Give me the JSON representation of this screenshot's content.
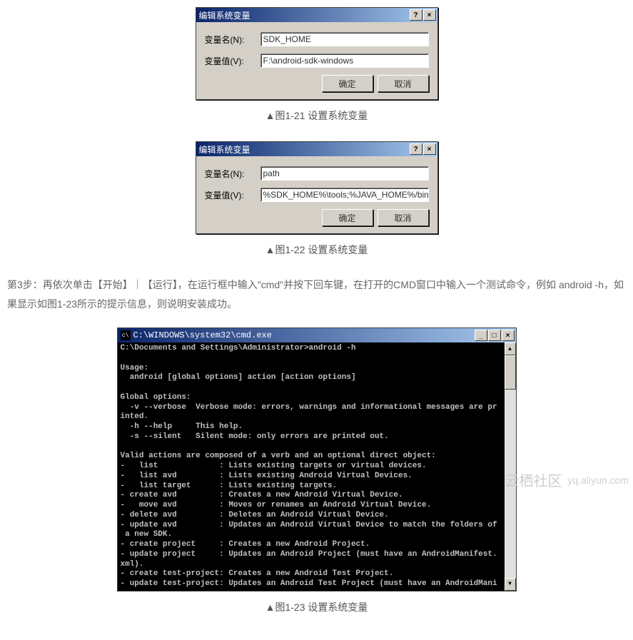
{
  "dialog1": {
    "title": "编辑系统变量",
    "name_label": "变量名(N):",
    "name_value": "SDK_HOME",
    "value_label": "变量值(V):",
    "value_value": "F:\\android-sdk-windows",
    "ok": "确定",
    "cancel": "取消"
  },
  "caption1": "▲图1-21 设置系统变量",
  "dialog2": {
    "title": "编辑系统变量",
    "name_label": "变量名(N):",
    "name_value": "path",
    "value_label": "变量值(V):",
    "value_value": "%SDK_HOME%\\tools;%JAVA_HOME%/bin;C:\\",
    "ok": "确定",
    "cancel": "取消"
  },
  "caption2": "▲图1-22 设置系统变量",
  "para1": "第3步：再依次单击【开始】｜【运行】，在运行框中输入\"cmd\"并按下回车键，在打开的CMD窗口中输入一个测试命令，例如 android -h，如果显示如图1-23所示的提示信息，则说明安装成功。",
  "cmd": {
    "title": "C:\\WINDOWS\\system32\\cmd.exe",
    "lines": "C:\\Documents and Settings\\Administrator>android -h\n\nUsage:\n  android [global options] action [action options]\n\nGlobal options:\n  -v --verbose  Verbose mode: errors, warnings and informational messages are pr\ninted.\n  -h --help     This help.\n  -s --silent   Silent mode: only errors are printed out.\n\nValid actions are composed of a verb and an optional direct object:\n-   list             : Lists existing targets or virtual devices.\n-   list avd         : Lists existing Android Virtual Devices.\n-   list target      : Lists existing targets.\n- create avd         : Creates a new Android Virtual Device.\n-   move avd         : Moves or renames an Android Virtual Device.\n- delete avd         : Deletes an Android Virtual Device.\n- update avd         : Updates an Android Virtual Device to match the folders of\n a new SDK.\n- create project     : Creates a new Android Project.\n- update project     : Updates an Android Project (must have an AndroidManifest.\nxml).\n- create test-project: Creates a new Android Test Project.\n- update test-project: Updates an Android Test Project (must have an AndroidMani"
  },
  "caption3": "▲图1-23 设置系统变量",
  "titlebar_help": "?",
  "titlebar_close": "×",
  "win_min": "_",
  "win_max": "□",
  "watermark_main": "云栖社区",
  "watermark_sub": "yq.aliyun.com"
}
